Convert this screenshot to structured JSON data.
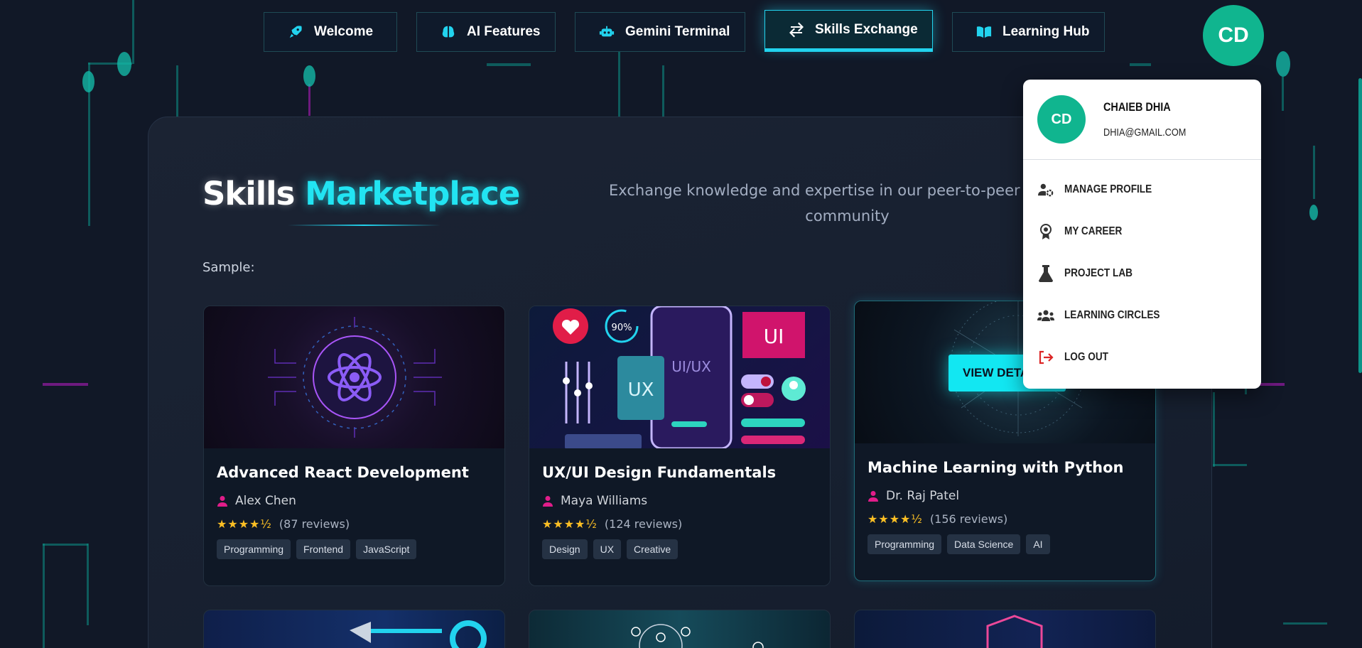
{
  "nav": {
    "tabs": [
      {
        "label": "Welcome",
        "icon": "rocket-icon"
      },
      {
        "label": "AI Features",
        "icon": "brain-icon"
      },
      {
        "label": "Gemini Terminal",
        "icon": "robot-icon"
      },
      {
        "label": "Skills Exchange",
        "icon": "exchange-icon",
        "active": true
      },
      {
        "label": "Learning Hub",
        "icon": "book-open-icon"
      }
    ],
    "avatar_initials": "CD"
  },
  "hero": {
    "title_part1": "Skills",
    "title_part2": "Marketplace",
    "subtitle": "Exchange knowledge and expertise in our peer-to-peer learning community",
    "sample_label": "Sample:"
  },
  "cards": [
    {
      "title": "Advanced React Development",
      "author": "Alex Chen",
      "stars": "★★★★½",
      "reviews": "(87 reviews)",
      "tags": [
        "Programming",
        "Frontend",
        "JavaScript"
      ]
    },
    {
      "title": "UX/UI Design Fundamentals",
      "author": "Maya Williams",
      "stars": "★★★★½",
      "reviews": "(124 reviews)",
      "tags": [
        "Design",
        "UX",
        "Creative"
      ],
      "image_text": {
        "ui": "UI",
        "ux": "UX",
        "uiux": "UI/UX",
        "percent": "90%"
      }
    },
    {
      "title": "Machine Learning with Python",
      "author": "Dr. Raj Patel",
      "stars": "★★★★½",
      "reviews": "(156 reviews)",
      "tags": [
        "Programming",
        "Data Science",
        "AI"
      ],
      "button_label": "VIEW DETAILS"
    }
  ],
  "user_menu": {
    "initials": "CD",
    "name": "Chaieb Dhia",
    "email": "dhia@gmail.com",
    "items": [
      {
        "label": "Manage Profile",
        "icon": "user-gear-icon"
      },
      {
        "label": "My Career",
        "icon": "award-icon"
      },
      {
        "label": "Project Lab",
        "icon": "flask-icon"
      },
      {
        "label": "Learning Circles",
        "icon": "users-icon"
      },
      {
        "label": "Log Out",
        "icon": "logout-icon"
      }
    ]
  },
  "colors": {
    "background": "#111827",
    "accent_cyan": "#22e4f2",
    "avatar_green": "#10b58f",
    "star_gold": "#fbbf24",
    "author_icon_pink": "#e11d8a"
  }
}
